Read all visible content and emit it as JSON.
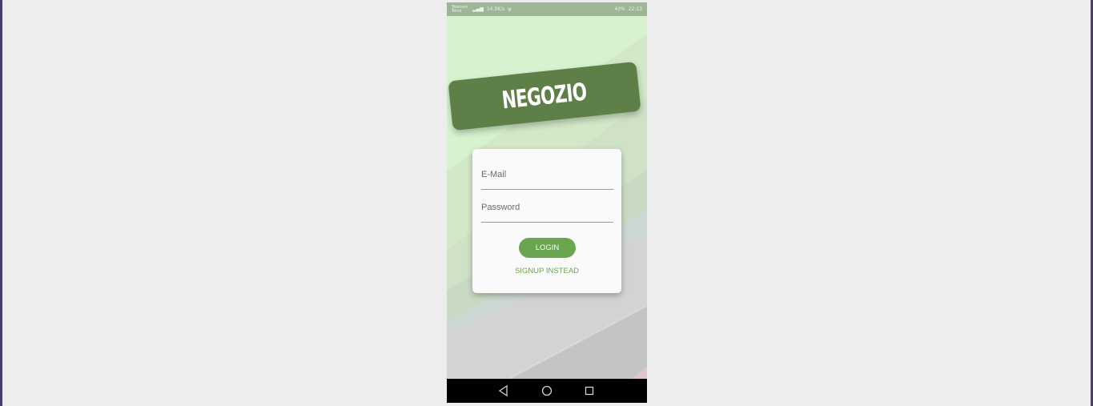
{
  "status_bar": {
    "carrier": "Telecom\nTelco",
    "speed": "14.5K/s",
    "battery": "43%",
    "time": "22:13"
  },
  "app": {
    "title": "NEGOZIO",
    "brand_color": "#5e8048",
    "accent_color": "#6aa650"
  },
  "login_form": {
    "email_label": "E-Mail",
    "password_label": "Password",
    "login_button": "LOGIN",
    "signup_link": "SIGNUP INSTEAD"
  },
  "navigation": {
    "back_icon": "back-triangle-icon",
    "home_icon": "home-circle-icon",
    "recents_icon": "recents-square-icon"
  }
}
